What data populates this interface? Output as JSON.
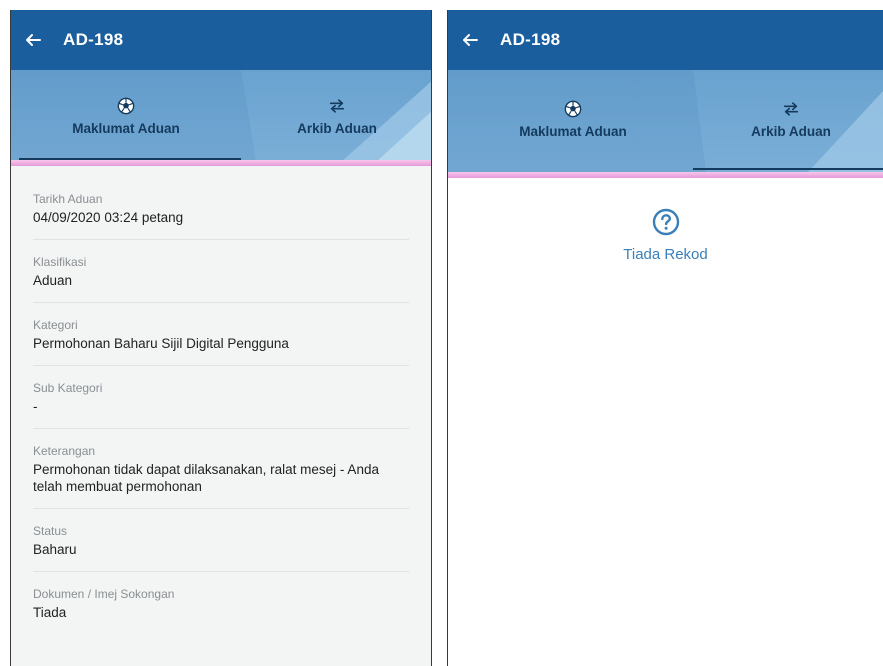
{
  "colors": {
    "appbar": "#1b5e9e",
    "tab_band": "#6aa2cf",
    "tab_text": "#143a5e",
    "accent_pink": "#e59ad8",
    "empty_text": "#3b7fb8"
  },
  "left": {
    "title": "AD-198",
    "tabs": [
      {
        "label": "Maklumat Aduan",
        "icon": "soccer-ball-icon",
        "active": true
      },
      {
        "label": "Arkib Aduan",
        "icon": "swap-arrows-icon",
        "active": false
      }
    ],
    "fields": [
      {
        "label": "Tarikh Aduan",
        "value": "04/09/2020 03:24 petang"
      },
      {
        "label": "Klasifikasi",
        "value": "Aduan"
      },
      {
        "label": "Kategori",
        "value": "Permohonan Baharu Sijil Digital Pengguna"
      },
      {
        "label": "Sub Kategori",
        "value": "-"
      },
      {
        "label": "Keterangan",
        "value": "Permohonan tidak dapat dilaksanakan, ralat mesej - Anda telah membuat permohonan"
      },
      {
        "label": "Status",
        "value": "Baharu"
      },
      {
        "label": "Dokumen / Imej Sokongan",
        "value": "Tiada"
      }
    ]
  },
  "right": {
    "title": "AD-198",
    "tabs": [
      {
        "label": "Maklumat Aduan",
        "icon": "soccer-ball-icon",
        "active": false
      },
      {
        "label": "Arkib Aduan",
        "icon": "swap-arrows-icon",
        "active": true
      }
    ],
    "empty_icon": "question-circle-icon",
    "empty_text": "Tiada Rekod"
  }
}
